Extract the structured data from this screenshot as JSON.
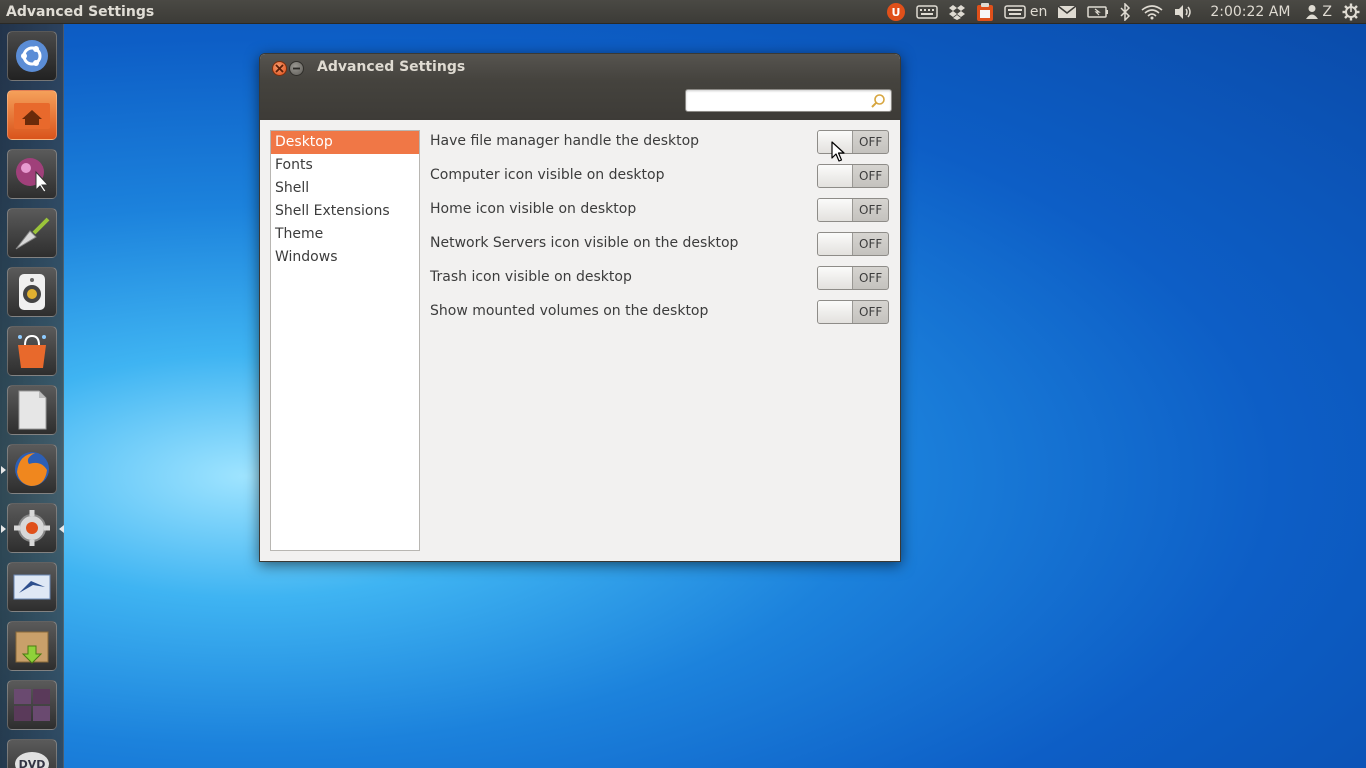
{
  "top_panel": {
    "app_title": "Advanced Settings",
    "keyboard_layout": "en",
    "clock": "2:00:22 AM",
    "user": "Z"
  },
  "window": {
    "title": "Advanced Settings",
    "search": {
      "value": "",
      "placeholder": ""
    },
    "sidebar": {
      "items": [
        {
          "label": "Desktop",
          "selected": true
        },
        {
          "label": "Fonts",
          "selected": false
        },
        {
          "label": "Shell",
          "selected": false
        },
        {
          "label": "Shell Extensions",
          "selected": false
        },
        {
          "label": "Theme",
          "selected": false
        },
        {
          "label": "Windows",
          "selected": false
        }
      ]
    },
    "settings": [
      {
        "label": "Have file manager handle the desktop",
        "state": "OFF"
      },
      {
        "label": "Computer icon visible on desktop",
        "state": "OFF"
      },
      {
        "label": "Home icon visible on desktop",
        "state": "OFF"
      },
      {
        "label": "Network Servers icon visible on the desktop",
        "state": "OFF"
      },
      {
        "label": "Trash icon visible on desktop",
        "state": "OFF"
      },
      {
        "label": "Show mounted volumes on the desktop",
        "state": "OFF"
      }
    ]
  },
  "launcher": {
    "items": [
      {
        "icon": "ubuntu-dash-icon"
      },
      {
        "icon": "home-folder-icon"
      },
      {
        "icon": "compiz-settings-icon"
      },
      {
        "icon": "trowel-tool-icon"
      },
      {
        "icon": "speaker-audio-icon"
      },
      {
        "icon": "software-center-icon"
      },
      {
        "icon": "libreoffice-icon"
      },
      {
        "icon": "firefox-icon"
      },
      {
        "icon": "system-settings-icon"
      },
      {
        "icon": "mail-bird-icon"
      },
      {
        "icon": "package-installer-icon"
      },
      {
        "icon": "workspace-switcher-icon"
      },
      {
        "icon": "dvd-icon"
      }
    ]
  },
  "colors": {
    "accent_selected": "#f07746",
    "panel": "#3c3b37",
    "close_button": "#e0501a"
  }
}
